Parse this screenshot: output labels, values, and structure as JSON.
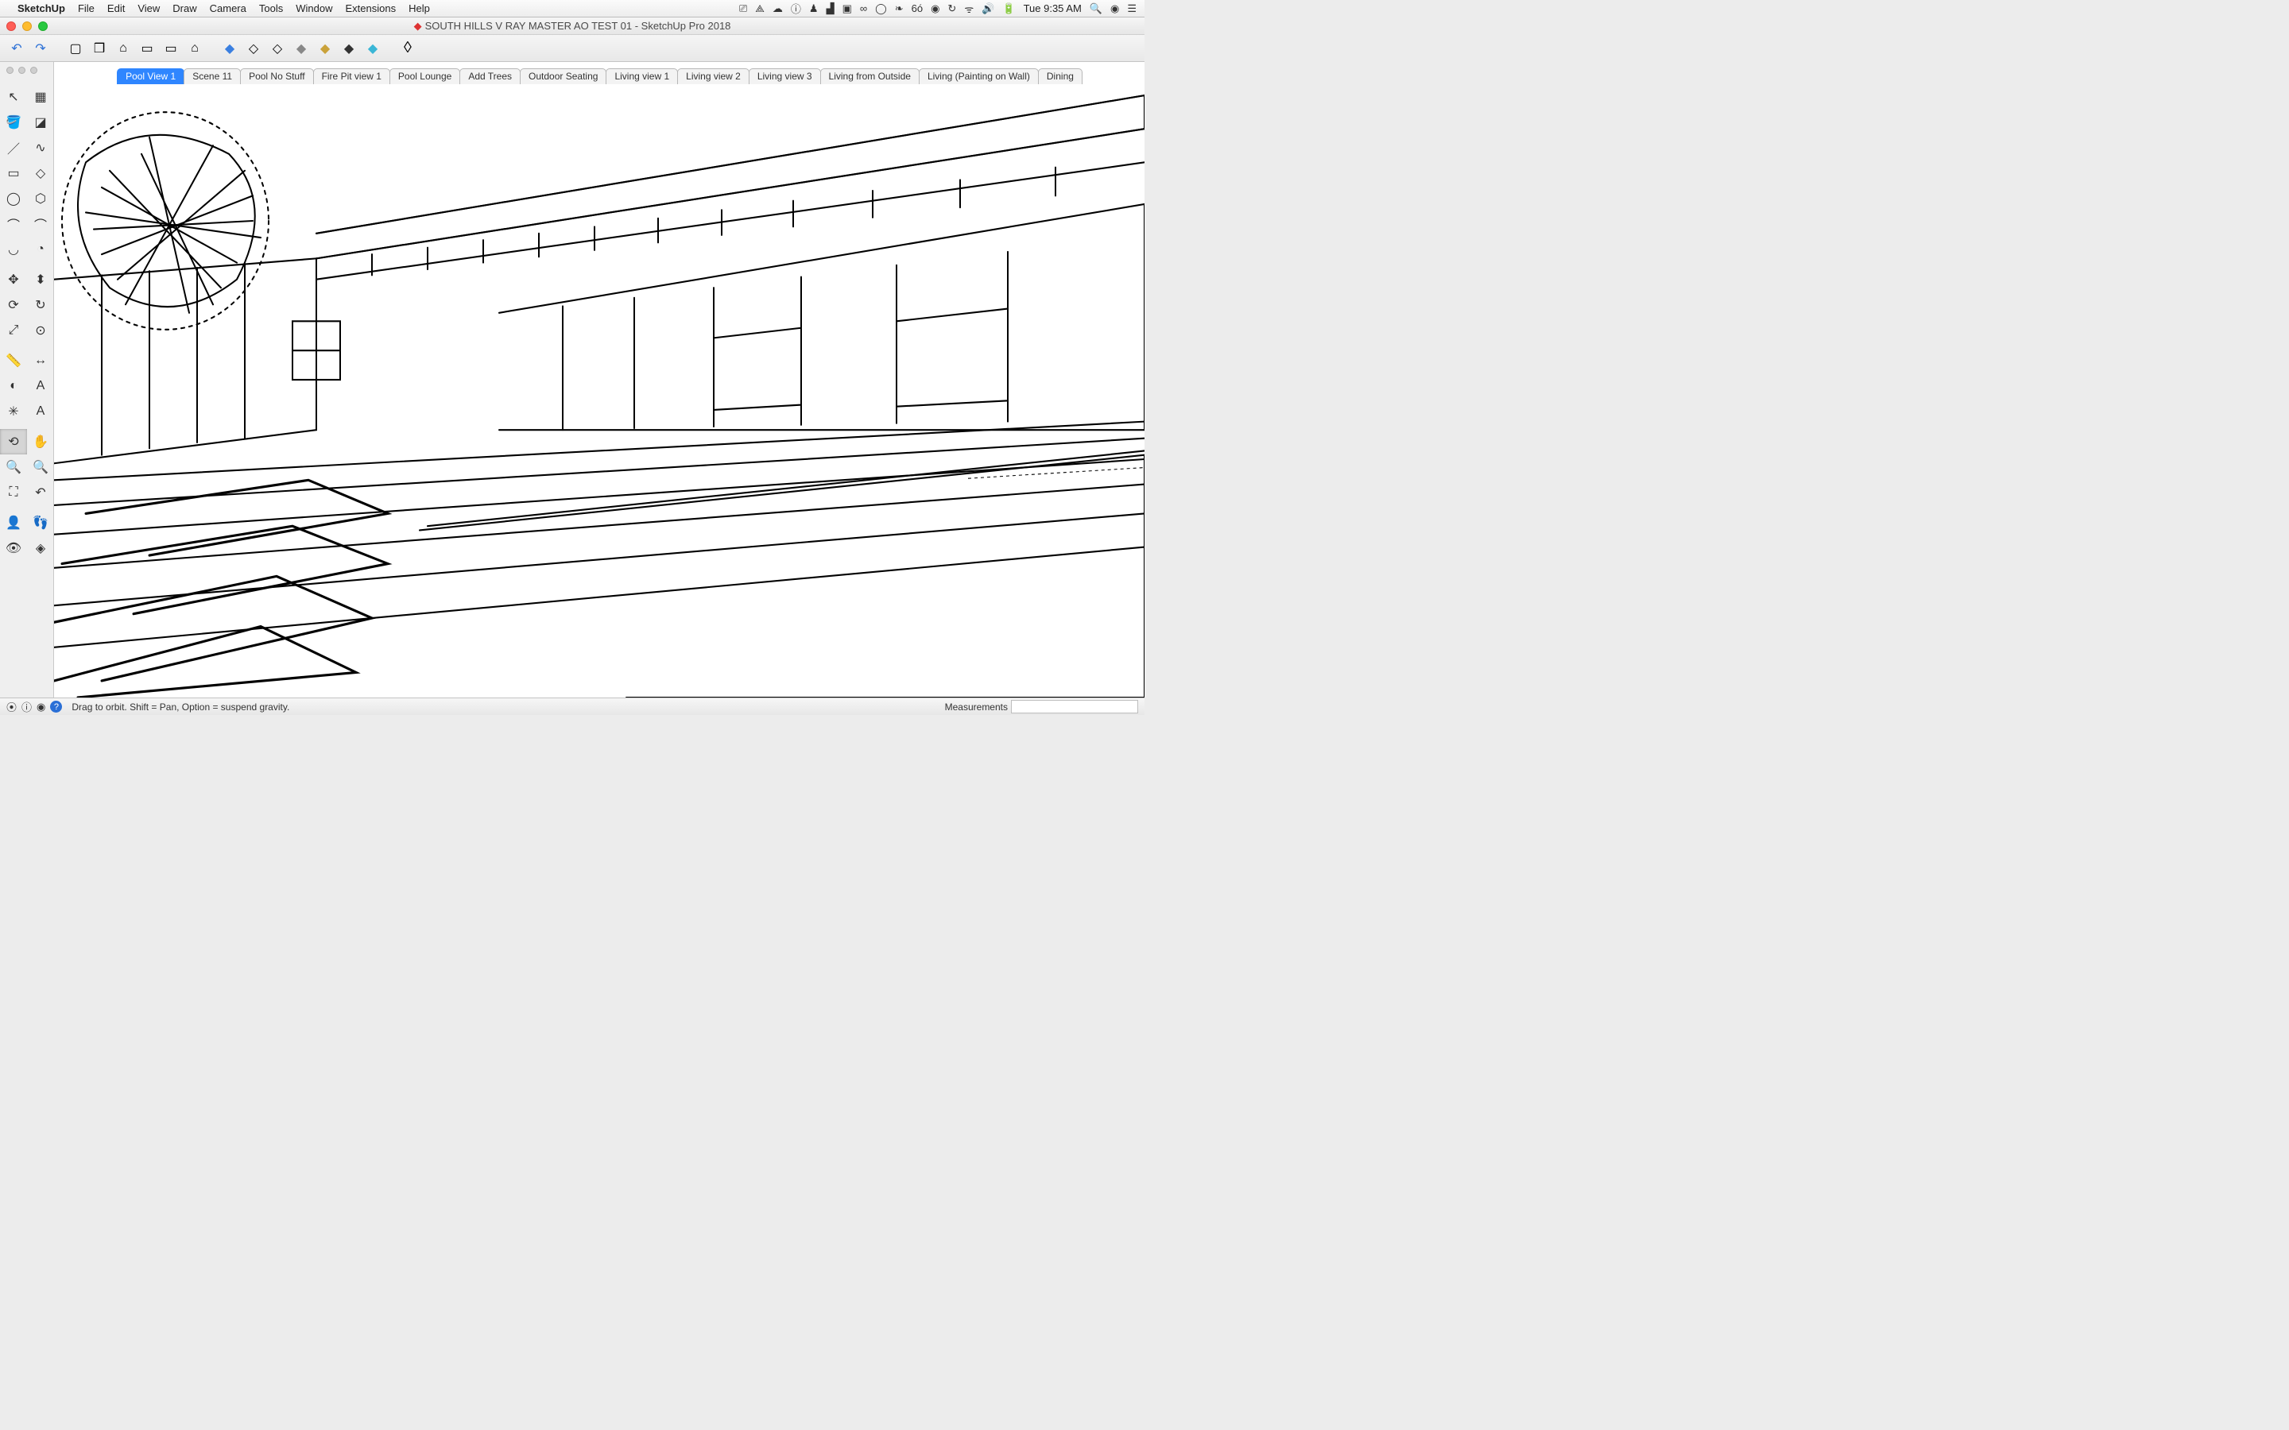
{
  "menubar": {
    "app": "SketchUp",
    "items": [
      "File",
      "Edit",
      "View",
      "Draw",
      "Camera",
      "Tools",
      "Window",
      "Extensions",
      "Help"
    ],
    "status_icons": [
      "camera-icon",
      "dropbox-icon",
      "cloud-icon",
      "info-icon",
      "candle-icon",
      "cloud2-icon",
      "panel-icon",
      "infinity-icon",
      "circle-icon",
      "evernote-icon",
      "eyedrop-icon",
      "record-icon",
      "history-icon",
      "wifi-icon",
      "volume-icon",
      "battery-icon"
    ],
    "status_glyphs": [
      "⏯",
      "�升",
      "☁",
      "ⓘ",
      "♟",
      "☁",
      "▣",
      "∞",
      "◯",
      "❧",
      "6ó",
      "◉",
      "↻",
      "ᯤ",
      "🔊",
      "🔋"
    ],
    "clock": "Tue 9:35 AM",
    "right_icons": [
      "search-icon",
      "siri-icon",
      "menu-icon"
    ],
    "right_glyphs": [
      "🔍",
      "◉",
      "☰"
    ]
  },
  "window": {
    "title": "SOUTH HILLS V RAY MASTER AO TEST 01 - SketchUp Pro 2018"
  },
  "toolbar": {
    "history": [
      "undo",
      "redo"
    ],
    "group_icons": [
      "box-icon",
      "cube-icon",
      "house-icon",
      "folder1-icon",
      "folder2-icon",
      "house2-icon"
    ],
    "style_icons": [
      "style-blue",
      "style-outline",
      "style-box",
      "style-grey",
      "style-yellow",
      "style-black",
      "style-cyan"
    ],
    "plugin_icon": "plugin-icon"
  },
  "scenes": {
    "active_index": 0,
    "tabs": [
      "Pool View 1",
      "Scene 11",
      "Pool No Stuff",
      "Fire Pit view 1",
      "Pool Lounge",
      "Add Trees",
      "Outdoor Seating",
      "Living view 1",
      "Living view 2",
      "Living view 3",
      "Living from Outside",
      "Living (Painting on Wall)",
      "Dining"
    ]
  },
  "tools": {
    "active_index": 26,
    "items": [
      {
        "name": "select-tool",
        "glyph": "↖"
      },
      {
        "name": "component-tool",
        "glyph": "▦"
      },
      {
        "name": "paint-bucket-tool",
        "glyph": "🪣"
      },
      {
        "name": "eraser-tool",
        "glyph": "◪"
      },
      {
        "name": "line-tool",
        "glyph": "／"
      },
      {
        "name": "freehand-tool",
        "glyph": "∿"
      },
      {
        "name": "rectangle-tool",
        "glyph": "▭"
      },
      {
        "name": "rotated-rect-tool",
        "glyph": "◇"
      },
      {
        "name": "circle-tool",
        "glyph": "◯"
      },
      {
        "name": "polygon-tool",
        "glyph": "⬡"
      },
      {
        "name": "arc-tool",
        "glyph": "⌒"
      },
      {
        "name": "arc2-tool",
        "glyph": "⌒"
      },
      {
        "name": "arc3-tool",
        "glyph": "◡"
      },
      {
        "name": "pie-tool",
        "glyph": "◔"
      },
      {
        "name": "move-tool",
        "glyph": "✥"
      },
      {
        "name": "pushpull-tool",
        "glyph": "⬍"
      },
      {
        "name": "rotate-tool",
        "glyph": "⟳"
      },
      {
        "name": "followme-tool",
        "glyph": "↻"
      },
      {
        "name": "scale-tool",
        "glyph": "⤢"
      },
      {
        "name": "offset-tool",
        "glyph": "⊙"
      },
      {
        "name": "tape-tool",
        "glyph": "📏"
      },
      {
        "name": "dimension-tool",
        "glyph": "↔"
      },
      {
        "name": "protractor-tool",
        "glyph": "◐"
      },
      {
        "name": "text-tool",
        "glyph": "A"
      },
      {
        "name": "axes-tool",
        "glyph": "✳"
      },
      {
        "name": "3dtext-tool",
        "glyph": "A"
      },
      {
        "name": "orbit-tool",
        "glyph": "⟲"
      },
      {
        "name": "pan-tool",
        "glyph": "✋"
      },
      {
        "name": "zoom-tool",
        "glyph": "🔍"
      },
      {
        "name": "zoom-window-tool",
        "glyph": "🔍"
      },
      {
        "name": "zoom-extents-tool",
        "glyph": "⛶"
      },
      {
        "name": "previous-tool",
        "glyph": "↶"
      },
      {
        "name": "position-camera-tool",
        "glyph": "👤"
      },
      {
        "name": "walk-tool",
        "glyph": "👣"
      },
      {
        "name": "lookaround-tool",
        "glyph": "👁"
      },
      {
        "name": "section-tool",
        "glyph": "◈"
      }
    ]
  },
  "statusbar": {
    "icons": [
      "geo-icon",
      "person-icon",
      "profile-icon",
      "help-icon"
    ],
    "glyphs": [
      "⦿",
      "⍜",
      "◉",
      "?"
    ],
    "hint": "Drag to orbit. Shift = Pan, Option = suspend gravity.",
    "measurements_label": "Measurements",
    "measurements_value": ""
  }
}
